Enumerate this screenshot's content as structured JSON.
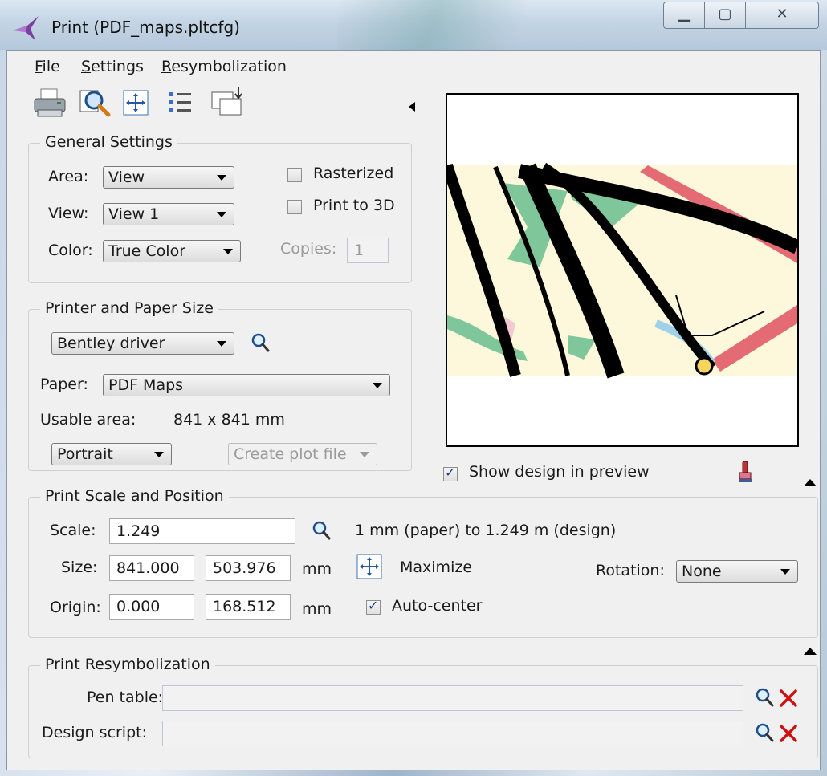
{
  "window": {
    "title": "Print  (PDF_maps.pltcfg)",
    "min_glyph": "▁",
    "max_glyph": "▢",
    "close_glyph": "✕"
  },
  "menu": {
    "file": "File",
    "settings": "Settings",
    "resymbolization": "Resymbolization"
  },
  "toolbar": {
    "icons": [
      "printer-icon",
      "preview-magnifier-icon",
      "maximize-icon",
      "list-icon",
      "batch-print-icon"
    ]
  },
  "general_settings": {
    "legend": "General Settings",
    "area_label": "Area:",
    "area_value": "View",
    "view_label": "View:",
    "view_value": "View 1",
    "color_label": "Color:",
    "color_value": "True Color",
    "rasterized_label": "Rasterized",
    "rasterized_checked": false,
    "print3d_label": "Print to 3D",
    "print3d_checked": false,
    "copies_label": "Copies:",
    "copies_value": "1"
  },
  "printer": {
    "legend": "Printer and Paper Size",
    "driver_value": "Bentley driver",
    "paper_label": "Paper:",
    "paper_value": "PDF Maps",
    "usable_area_label": "Usable area:",
    "usable_area_value": "841 x 841 mm",
    "orientation_value": "Portrait",
    "plot_file_value": "Create plot file"
  },
  "preview": {
    "show_design_label": "Show design in preview",
    "show_design_checked": true
  },
  "scale": {
    "legend": "Print Scale and Position",
    "scale_label": "Scale:",
    "scale_value": "1.249",
    "scale_desc": "1 mm (paper) to 1.249 m (design)",
    "size_label": "Size:",
    "size_w": "841.000",
    "size_h": "503.976",
    "size_unit": "mm",
    "maximize_label": "Maximize",
    "rotation_label": "Rotation:",
    "rotation_value": "None",
    "origin_label": "Origin:",
    "origin_x": "0.000",
    "origin_y": "168.512",
    "origin_unit": "mm",
    "autocenter_label": "Auto-center",
    "autocenter_checked": true
  },
  "resym": {
    "legend": "Print Resymbolization",
    "pen_table_label": "Pen table:",
    "pen_table_value": "",
    "design_script_label": "Design script:",
    "design_script_value": ""
  },
  "colors": {
    "accent_red": "#d01010",
    "map_paper": "#fdf8dc",
    "map_green": "#7fc79a",
    "map_road_red": "#e46a73",
    "map_river": "#9fd2ea"
  }
}
